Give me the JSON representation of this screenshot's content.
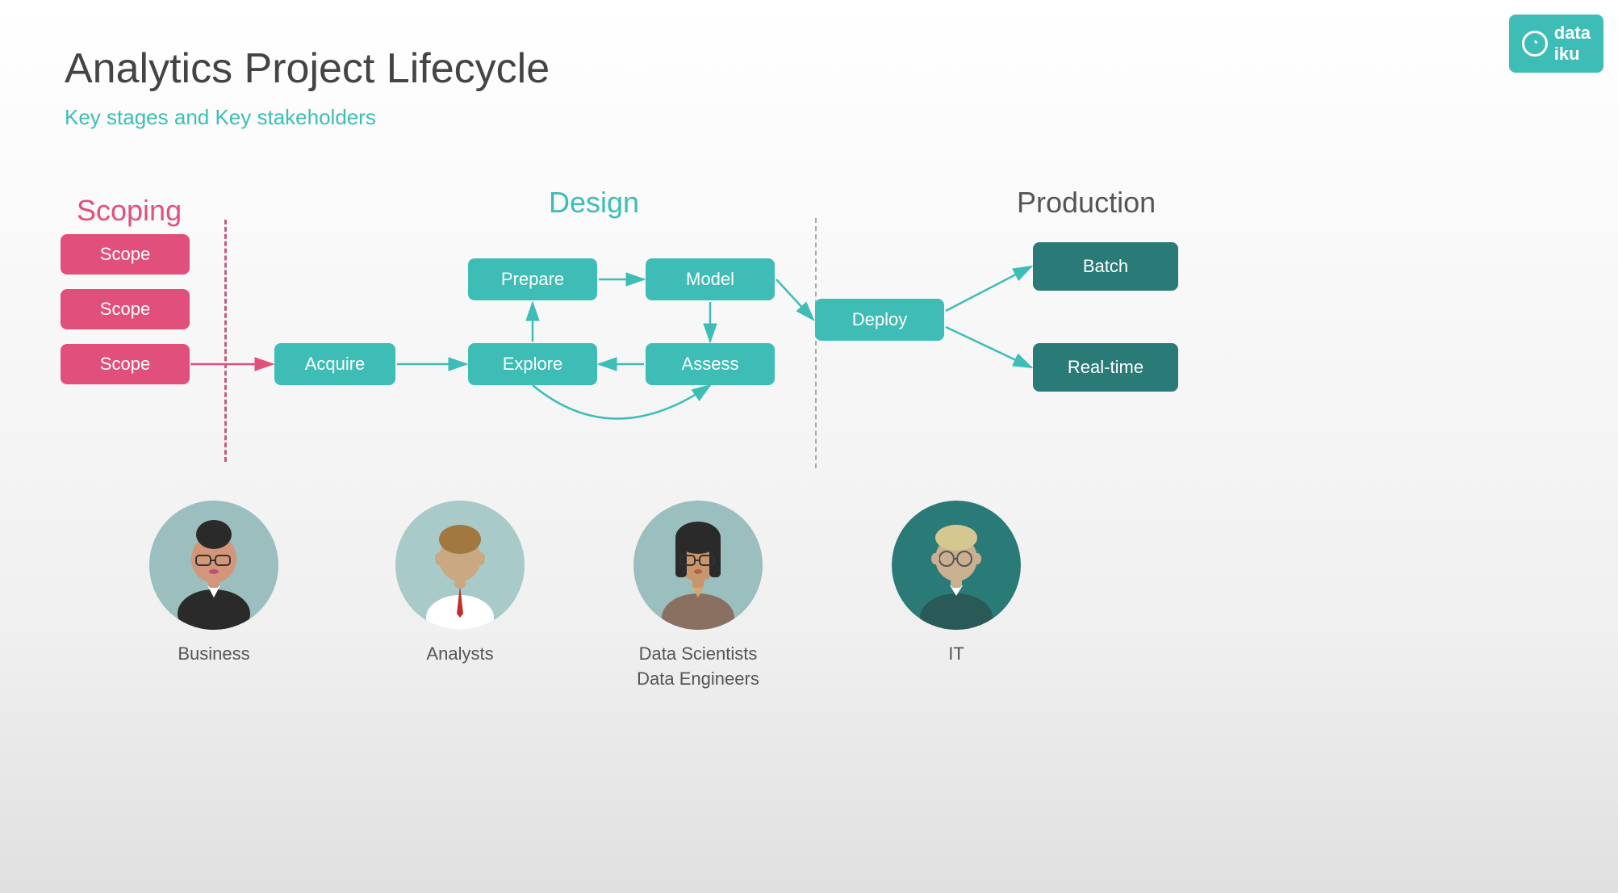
{
  "title": "Analytics Project Lifecycle",
  "subtitle": "Key stages and Key stakeholders",
  "logo": {
    "text": "data iku",
    "icon": "◔"
  },
  "scoping": {
    "label": "Scoping",
    "boxes": [
      "Scope",
      "Scope",
      "Scope"
    ]
  },
  "design": {
    "label": "Design",
    "nodes": [
      "Prepare",
      "Model",
      "Explore",
      "Assess"
    ]
  },
  "flow": {
    "acquire": "Acquire",
    "deploy": "Deploy",
    "batch": "Batch",
    "realtime": "Real-time"
  },
  "production": {
    "label": "Production"
  },
  "stakeholders": [
    {
      "id": "business",
      "label": "Business"
    },
    {
      "id": "analysts",
      "label": "Analysts"
    },
    {
      "id": "datascientists",
      "label": "Data Scientists\nData Engineers"
    },
    {
      "id": "it",
      "label": "IT"
    }
  ]
}
